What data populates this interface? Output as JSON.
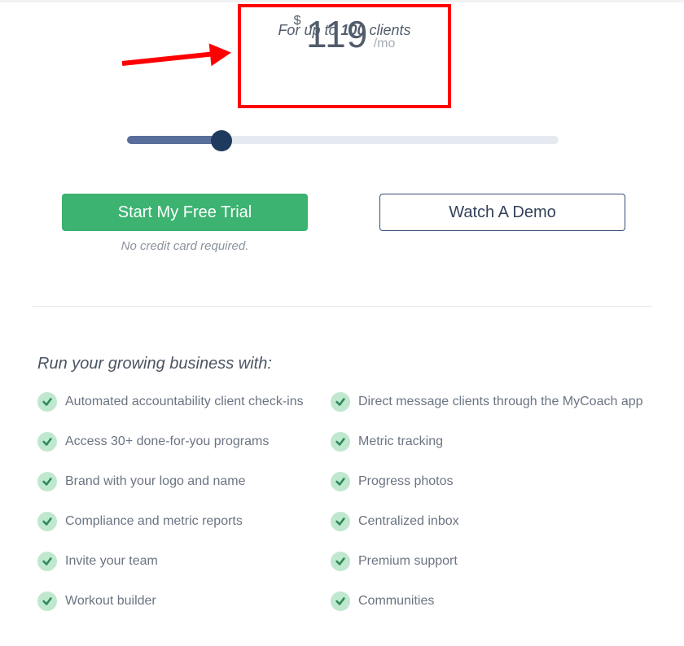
{
  "pricing": {
    "currency": "$",
    "amount": "119",
    "period": "/mo",
    "clients_prefix": "For up to ",
    "clients_count": "100",
    "clients_suffix": " clients"
  },
  "slider": {
    "fill_percent": 22
  },
  "cta": {
    "primary": "Start My Free Trial",
    "secondary": "Watch A Demo",
    "note": "No credit card required."
  },
  "features": {
    "heading": "Run your growing business with:",
    "items": [
      "Automated accountability client check-ins",
      "Direct message clients through the MyCoach app",
      "Access 30+ done-for-you programs",
      "Metric tracking",
      "Brand with your logo and name",
      "Progress photos",
      "Compliance and metric reports",
      "Centralized inbox",
      "Invite your team",
      "Premium support",
      "Workout builder",
      "Communities"
    ]
  },
  "annotation": {
    "highlight_box": true,
    "arrow": true
  },
  "colors": {
    "accent_green": "#3cb371",
    "highlight_red": "#ff0000",
    "slider_fill": "#5a6e9b",
    "slider_knob": "#1f3a5f"
  }
}
